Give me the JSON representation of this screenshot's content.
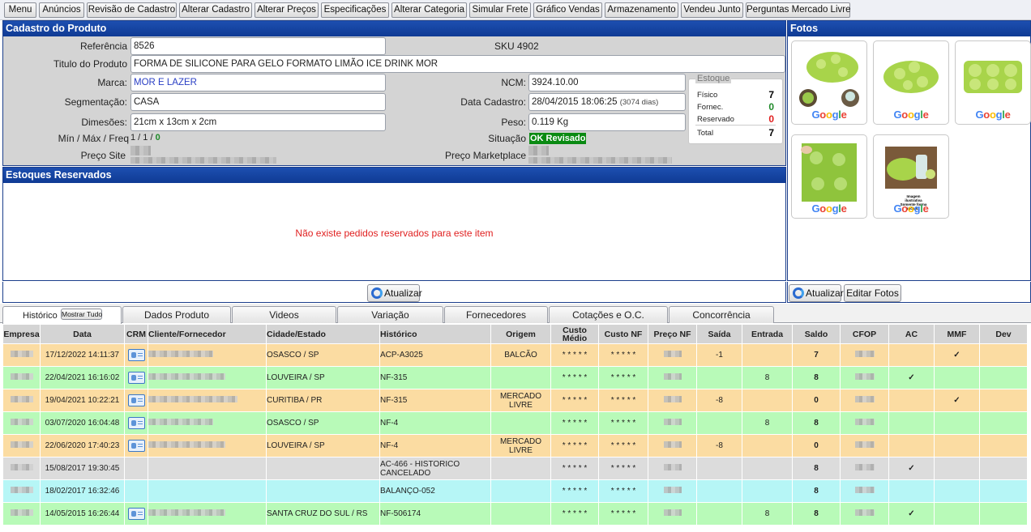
{
  "topnav": [
    "Menu",
    "Anúncios",
    "Revisão de Cadastro",
    "Alterar Cadastro",
    "Alterar Preços",
    "Especificações",
    "Alterar Categoria",
    "Simular Frete",
    "Gráfico Vendas",
    "Armazenamento",
    "Vendeu Junto",
    "Perguntas Mercado Livre"
  ],
  "cadastro": {
    "title": "Cadastro do Produto",
    "referencia_label": "Referência",
    "referencia": "8526",
    "sku": "SKU 4902",
    "titulo_label": "Titulo do Produto",
    "titulo": "FORMA DE SILICONE PARA GELO FORMATO LIMÃO ICE DRINK MOR",
    "marca_label": "Marca:",
    "marca": "MOR E LAZER",
    "ncm_label": "NCM:",
    "ncm": "3924.10.00",
    "segmentacao_label": "Segmentação:",
    "segmentacao": "CASA",
    "data_cadastro_label": "Data Cadastro:",
    "data_cadastro": "28/04/2015 18:06:25",
    "data_cadastro_dias": "(3074 dias)",
    "dimensoes_label": "Dimesões:",
    "dimensoes": "21cm x 13cm x 2cm",
    "peso_label": "Peso:",
    "peso": "0.119 Kg",
    "minmax_label": "Mín / Máx / Freq",
    "minmax": "1 / 1 /",
    "minmax_freq": "0",
    "situacao_label": "Situação",
    "situacao": "OK Revisado",
    "preco_site_label": "Preço Site",
    "preco_marketplace_label": "Preço Marketplace"
  },
  "estoque": {
    "legend": "Estoque",
    "fisico_label": "Físico",
    "fisico": "7",
    "fornec_label": "Fornec.",
    "fornec": "0",
    "reservado_label": "Reservado",
    "reservado": "0",
    "total_label": "Total",
    "total": "7"
  },
  "fotos": {
    "title": "Fotos",
    "watermark": "Google",
    "photo4_caption": "Imagem ilustrativa Somente forma inclusa"
  },
  "reservados": {
    "title": "Estoques Reservados",
    "empty_msg": "Não existe pedidos reservados para este item"
  },
  "buttons": {
    "atualizar": "Atualizar",
    "atualizar2": "Atualizar",
    "editar_fotos": "Editar Fotos",
    "mostrar_tudo": "Mostrar Tudo"
  },
  "tabs": [
    "Histórico",
    "Dados Produto",
    "Videos",
    "Variação",
    "Fornecedores",
    "Cotações e O.C.",
    "Concorrência"
  ],
  "table": {
    "headers": [
      "Empresa",
      "Data",
      "CRM",
      "Cliente/Fornecedor",
      "Cidade/Estado",
      "Histórico",
      "Origem",
      "Custo Médio",
      "Custo NF",
      "Preço NF",
      "Saída",
      "Entrada",
      "Saldo",
      "CFOP",
      "AC",
      "MMF",
      "Dev"
    ],
    "rows": [
      {
        "color": "or",
        "data": "17/12/2022 14:11:37",
        "crm": true,
        "cidade": "OSASCO / SP",
        "historico": "ACP-A3025",
        "origem": "BALCÃO",
        "custo_medio": "* * * * *",
        "custo_nf": "* * * * *",
        "saida": "-1",
        "entrada": "",
        "saldo": "7",
        "ac": "",
        "mmf": "✓"
      },
      {
        "color": "gr",
        "data": "22/04/2021 16:16:02",
        "crm": true,
        "cidade": "LOUVEIRA / SP",
        "historico": "NF-315",
        "origem": "",
        "custo_medio": "* * * * *",
        "custo_nf": "* * * * *",
        "saida": "",
        "entrada": "8",
        "saldo": "8",
        "ac": "✓",
        "mmf": ""
      },
      {
        "color": "or",
        "data": "19/04/2021 10:22:21",
        "crm": true,
        "cidade": "CURITIBA / PR",
        "historico": "NF-315",
        "origem": "MERCADO LIVRE",
        "custo_medio": "* * * * *",
        "custo_nf": "* * * * *",
        "saida": "-8",
        "entrada": "",
        "saldo": "0",
        "ac": "",
        "mmf": "✓"
      },
      {
        "color": "gr",
        "data": "03/07/2020 16:04:48",
        "crm": true,
        "cidade": "OSASCO / SP",
        "historico": "NF-4",
        "origem": "",
        "custo_medio": "* * * * *",
        "custo_nf": "* * * * *",
        "saida": "",
        "entrada": "8",
        "saldo": "8",
        "ac": "",
        "mmf": ""
      },
      {
        "color": "or",
        "data": "22/06/2020 17:40:23",
        "crm": true,
        "cidade": "LOUVEIRA / SP",
        "historico": "NF-4",
        "origem": "MERCADO LIVRE",
        "custo_medio": "* * * * *",
        "custo_nf": "* * * * *",
        "saida": "-8",
        "entrada": "",
        "saldo": "0",
        "ac": "",
        "mmf": ""
      },
      {
        "color": "gy",
        "data": "15/08/2017 19:30:45",
        "crm": false,
        "cidade": "",
        "historico": "AC-466 - HISTORICO CANCELADO",
        "origem": "",
        "custo_medio": "* * * * *",
        "custo_nf": "* * * * *",
        "saida": "",
        "entrada": "",
        "saldo": "8",
        "ac": "✓",
        "mmf": ""
      },
      {
        "color": "cy",
        "data": "18/02/2017 16:32:46",
        "crm": false,
        "cidade": "",
        "historico": "BALANÇO-052",
        "origem": "",
        "custo_medio": "* * * * *",
        "custo_nf": "* * * * *",
        "saida": "",
        "entrada": "",
        "saldo": "8",
        "ac": "",
        "mmf": ""
      },
      {
        "color": "gr",
        "data": "14/05/2015 16:26:44",
        "crm": true,
        "cidade": "SANTA CRUZ DO SUL / RS",
        "historico": "NF-506174",
        "origem": "",
        "custo_medio": "* * * * *",
        "custo_nf": "* * * * *",
        "saida": "",
        "entrada": "8",
        "saldo": "8",
        "ac": "✓",
        "mmf": ""
      }
    ]
  },
  "colors": {
    "header_blue": "#1d4fb0",
    "ok_green": "#1f8a2a",
    "row_orange": "#fbdca2",
    "row_green": "#b8fab8",
    "row_gray": "#dcdcdc",
    "row_cyan": "#b6f6f6"
  }
}
